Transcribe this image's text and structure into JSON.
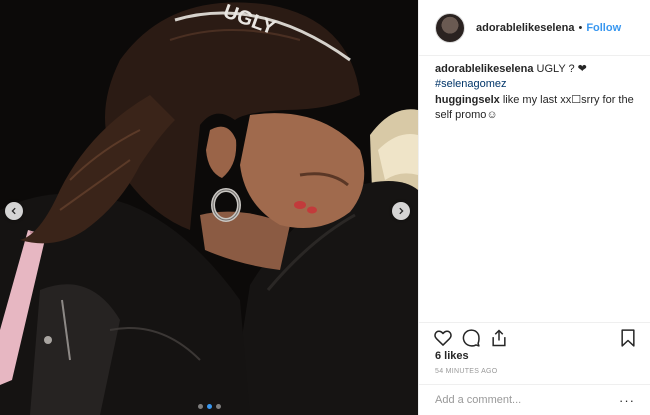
{
  "media": {
    "headband_text": "UGLY",
    "slide_count": 3,
    "active_slide": 2
  },
  "header": {
    "username": "adorablelikeselena",
    "separator": "•",
    "follow_label": "Follow"
  },
  "caption": {
    "username": "adorablelikeselena",
    "text": "UGLY ? ❤",
    "hashtag": "#selenagomez"
  },
  "comments": [
    {
      "username": "huggingselx",
      "text": "like my last xx☐srry for the self promo☺"
    }
  ],
  "stats": {
    "likes": "6 likes",
    "time": "54 MINUTES AGO"
  },
  "composer": {
    "placeholder": "Add a comment..."
  },
  "icons": {
    "like": "heart-icon",
    "comment": "comment-icon",
    "share": "share-icon",
    "save": "bookmark-icon",
    "prev": "chevron-left-icon",
    "next": "chevron-right-icon",
    "more": "more-options-icon"
  },
  "colors": {
    "link": "#3897f0",
    "hashtag": "#003569",
    "muted": "#999999",
    "text": "#262626"
  }
}
